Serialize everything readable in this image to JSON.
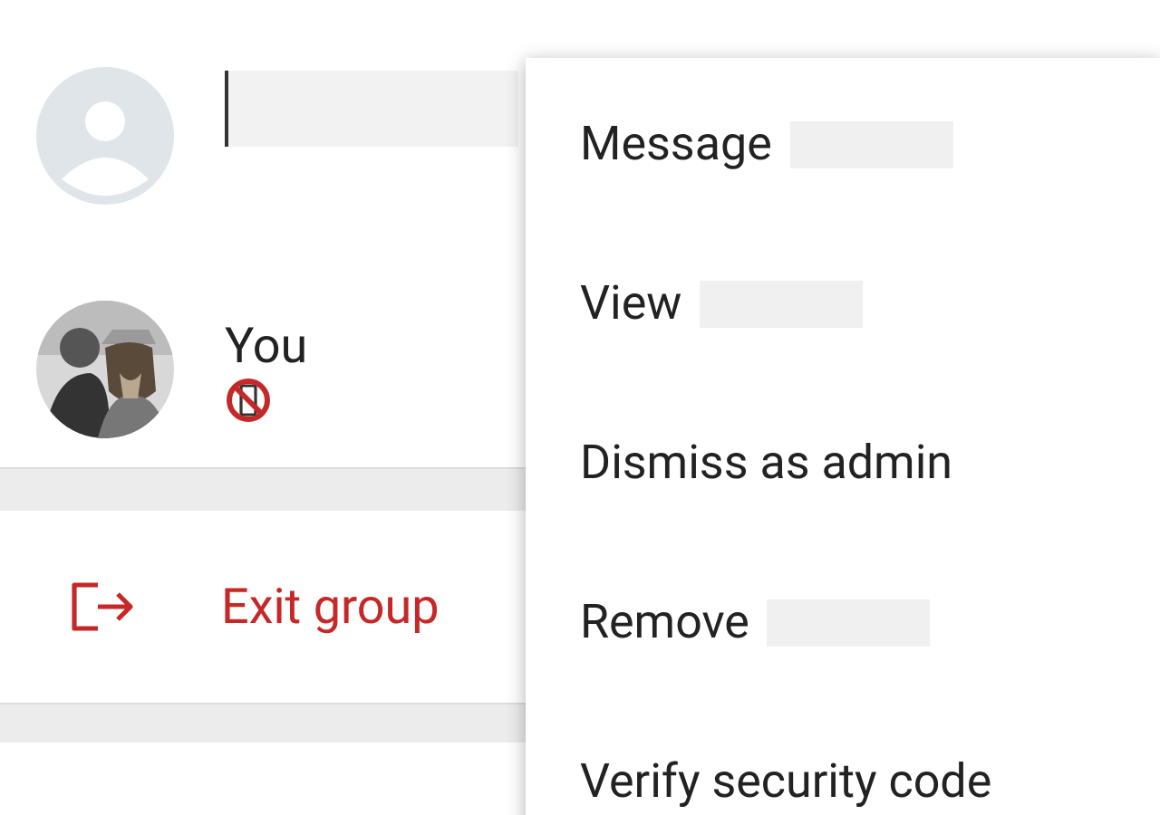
{
  "members": [
    {
      "kind": "default",
      "name_redacted": true
    },
    {
      "name": "You",
      "phone_unavailable": true
    }
  ],
  "exit_action": {
    "label": "Exit group"
  },
  "menu": {
    "items": [
      {
        "label": "Message",
        "redacted": true
      },
      {
        "label": "View",
        "redacted": true
      },
      {
        "label": "Dismiss as admin",
        "redacted": false
      },
      {
        "label": "Remove",
        "redacted": true
      },
      {
        "label": "Verify security code",
        "redacted": false
      }
    ]
  }
}
